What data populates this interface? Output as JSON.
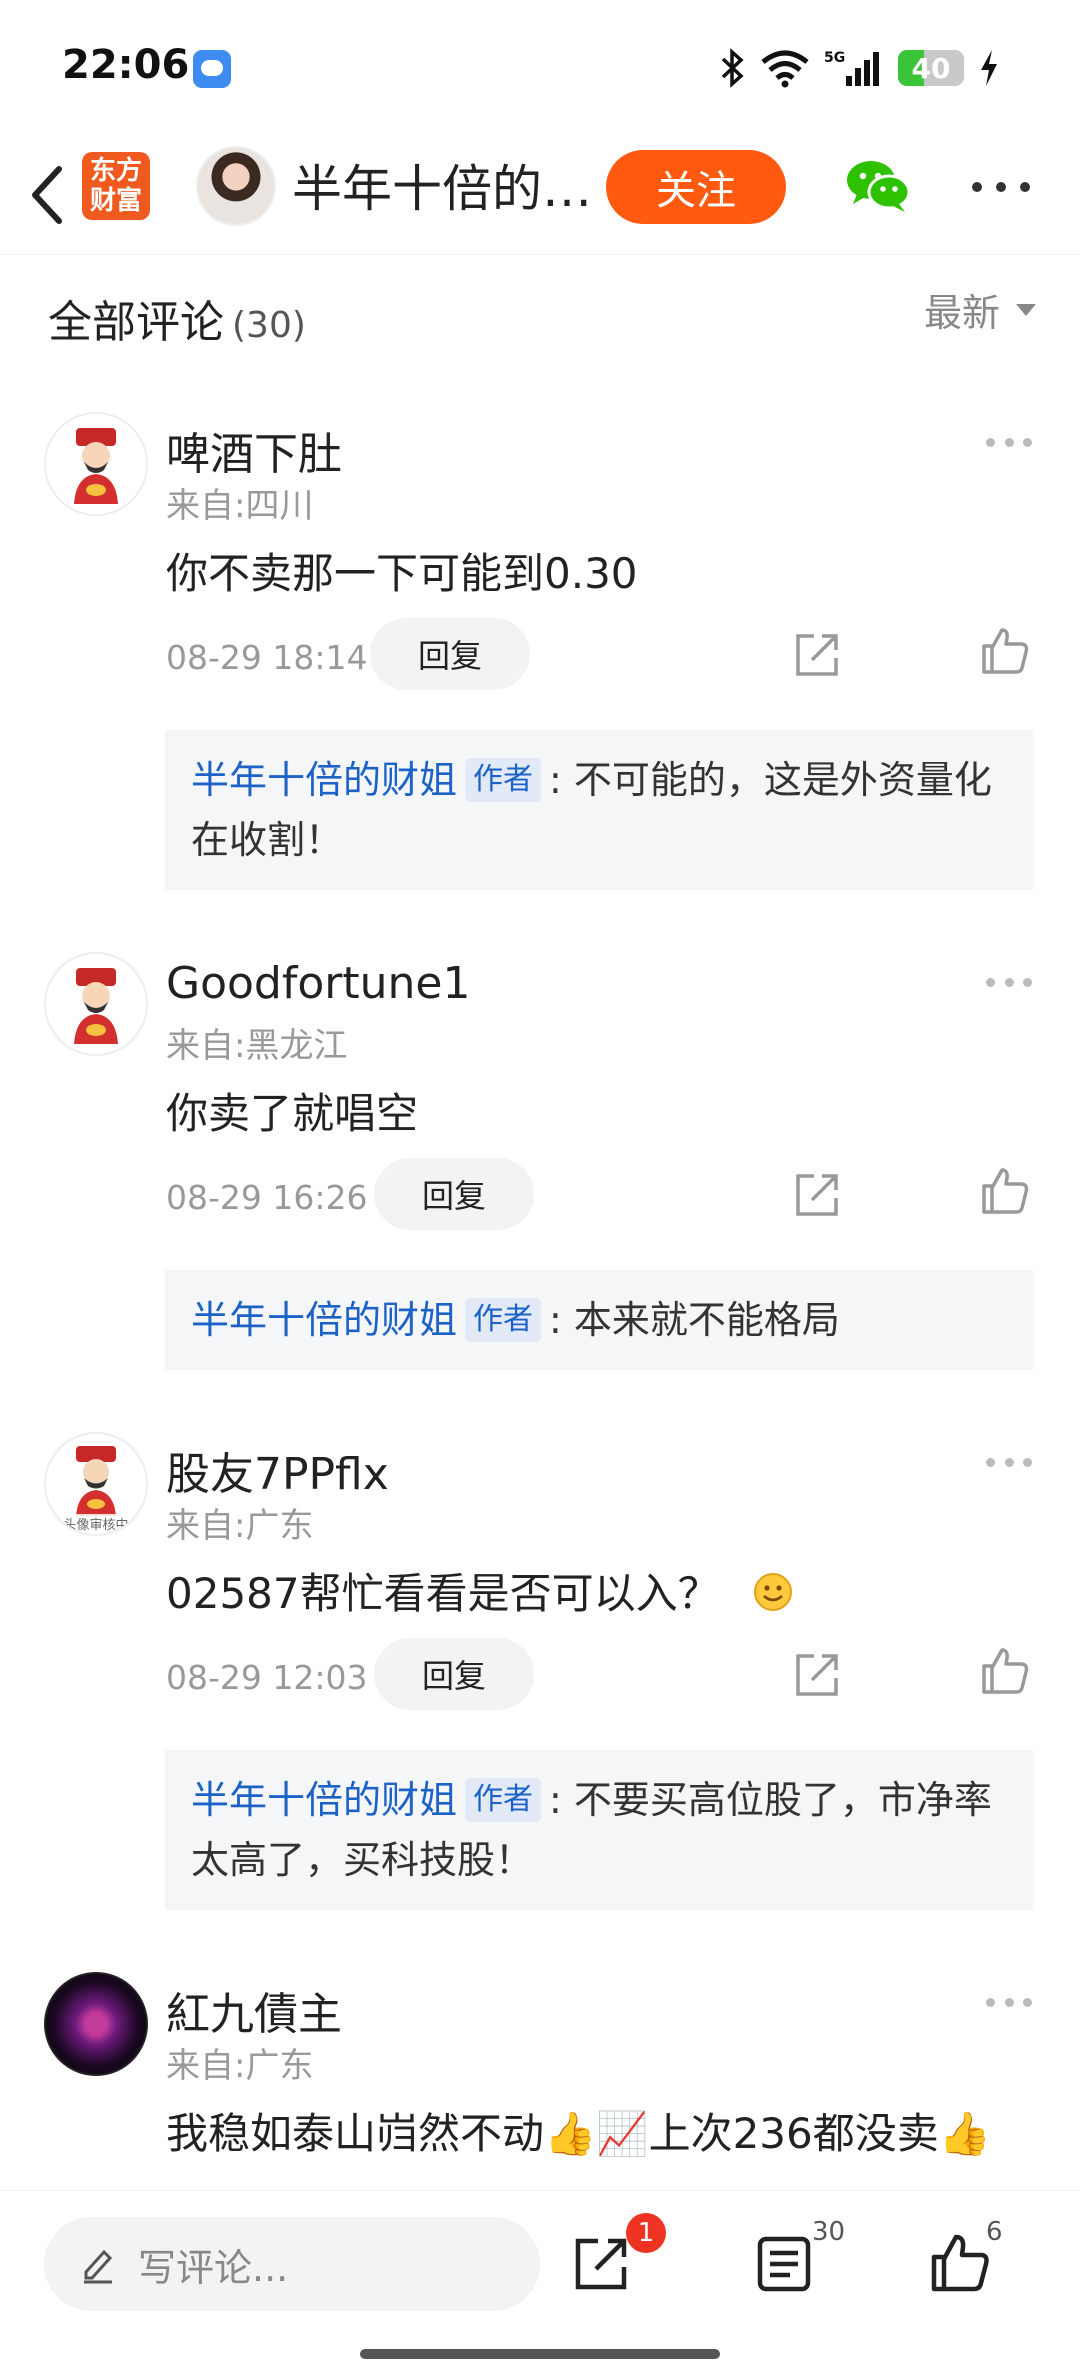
{
  "status_bar": {
    "time": "22:06",
    "network": "5G",
    "battery": "40",
    "battery_level": 0.4
  },
  "nav": {
    "brand_logo_text": "东方财富",
    "title": "半年十倍的财姐",
    "follow_label": "关注",
    "icons": [
      "back-icon",
      "wechat-icon",
      "more-icon"
    ]
  },
  "comments_header": {
    "title": "全部评论",
    "count": "(30)",
    "sort_label": "最新"
  },
  "comments": [
    {
      "name": "啤酒下肚",
      "location": "来自:四川",
      "text": "你不卖那一下可能到0.30",
      "time": "08-29 18:14",
      "reply_label": "回复",
      "reply": {
        "author": "半年十倍的财姐",
        "tag": "作者",
        "text": ": 不可能的，这是外资量化在收割！"
      }
    },
    {
      "name": "Goodfortune1",
      "location": "来自:黑龙江",
      "text": "你卖了就唱空",
      "time": "08-29 16:26",
      "reply_label": "回复",
      "reply": {
        "author": "半年十倍的财姐",
        "tag": "作者",
        "text": ": 本来就不能格局"
      }
    },
    {
      "name": "股友7PPflx",
      "location": "来自:广东",
      "text": "02587帮忙看看是否可以入？",
      "avatar_caption": "头像审核中",
      "time": "08-29 12:03",
      "reply_label": "回复",
      "reply": {
        "author": "半年十倍的财姐",
        "tag": "作者",
        "text": ": 不要买高位股了，市净率太高了，买科技股！"
      }
    },
    {
      "name": "紅九債主",
      "location": "来自:广东",
      "text": "我稳如泰山岿然不动👍📈上次236都没卖👍"
    }
  ],
  "bottom_bar": {
    "write_placeholder": "写评论...",
    "share_badge": "1",
    "comment_count": "30",
    "like_count": "6"
  },
  "colors": {
    "accent": "#ff5a10",
    "author_link": "#1d62c7",
    "badge": "#ee3322"
  }
}
